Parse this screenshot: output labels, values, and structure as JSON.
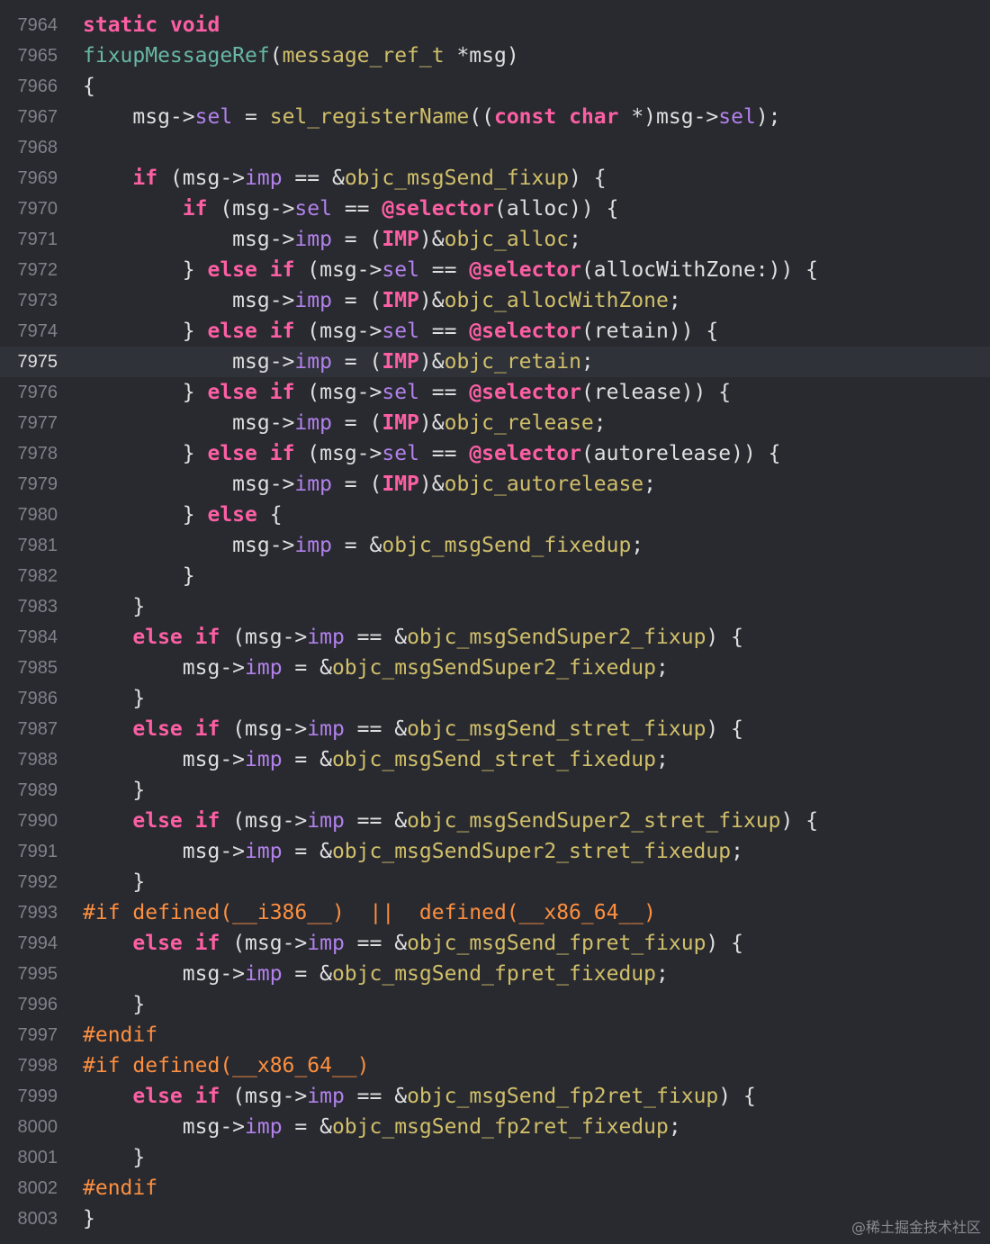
{
  "editor": {
    "current_line": "7975",
    "lines": [
      {
        "num": "7964",
        "tokens": [
          [
            "kw",
            "static"
          ],
          [
            "p",
            " "
          ],
          [
            "kw",
            "void"
          ]
        ]
      },
      {
        "num": "7965",
        "tokens": [
          [
            "fn",
            "fixupMessageRef"
          ],
          [
            "p",
            "("
          ],
          [
            "ty",
            "message_ref_t"
          ],
          [
            "p",
            " *msg)"
          ]
        ]
      },
      {
        "num": "7966",
        "tokens": [
          [
            "p",
            "{"
          ]
        ]
      },
      {
        "num": "7967",
        "tokens": [
          [
            "p",
            "    msg->"
          ],
          [
            "prop",
            "sel"
          ],
          [
            "p",
            " = "
          ],
          [
            "ty",
            "sel_registerName"
          ],
          [
            "p",
            "(("
          ],
          [
            "kw",
            "const"
          ],
          [
            "p",
            " "
          ],
          [
            "kw",
            "char"
          ],
          [
            "p",
            " *)msg->"
          ],
          [
            "prop",
            "sel"
          ],
          [
            "p",
            ");"
          ]
        ]
      },
      {
        "num": "7968",
        "tokens": []
      },
      {
        "num": "7969",
        "tokens": [
          [
            "p",
            "    "
          ],
          [
            "kw",
            "if"
          ],
          [
            "p",
            " (msg->"
          ],
          [
            "prop",
            "imp"
          ],
          [
            "p",
            " == &"
          ],
          [
            "ty",
            "objc_msgSend_fixup"
          ],
          [
            "p",
            ") {"
          ]
        ]
      },
      {
        "num": "7970",
        "tokens": [
          [
            "p",
            "        "
          ],
          [
            "kw",
            "if"
          ],
          [
            "p",
            " (msg->"
          ],
          [
            "prop",
            "sel"
          ],
          [
            "p",
            " == "
          ],
          [
            "kw",
            "@selector"
          ],
          [
            "p",
            "(alloc)) {"
          ]
        ]
      },
      {
        "num": "7971",
        "tokens": [
          [
            "p",
            "            msg->"
          ],
          [
            "prop",
            "imp"
          ],
          [
            "p",
            " = ("
          ],
          [
            "kw",
            "IMP"
          ],
          [
            "p",
            ")&"
          ],
          [
            "ty",
            "objc_alloc"
          ],
          [
            "p",
            ";"
          ]
        ]
      },
      {
        "num": "7972",
        "tokens": [
          [
            "p",
            "        } "
          ],
          [
            "kw",
            "else"
          ],
          [
            "p",
            " "
          ],
          [
            "kw",
            "if"
          ],
          [
            "p",
            " (msg->"
          ],
          [
            "prop",
            "sel"
          ],
          [
            "p",
            " == "
          ],
          [
            "kw",
            "@selector"
          ],
          [
            "p",
            "(allocWithZone:)) {"
          ]
        ]
      },
      {
        "num": "7973",
        "tokens": [
          [
            "p",
            "            msg->"
          ],
          [
            "prop",
            "imp"
          ],
          [
            "p",
            " = ("
          ],
          [
            "kw",
            "IMP"
          ],
          [
            "p",
            ")&"
          ],
          [
            "ty",
            "objc_allocWithZone"
          ],
          [
            "p",
            ";"
          ]
        ]
      },
      {
        "num": "7974",
        "tokens": [
          [
            "p",
            "        } "
          ],
          [
            "kw",
            "else"
          ],
          [
            "p",
            " "
          ],
          [
            "kw",
            "if"
          ],
          [
            "p",
            " (msg->"
          ],
          [
            "prop",
            "sel"
          ],
          [
            "p",
            " == "
          ],
          [
            "kw",
            "@selector"
          ],
          [
            "p",
            "(retain)) {"
          ]
        ]
      },
      {
        "num": "7975",
        "tokens": [
          [
            "p",
            "            msg->"
          ],
          [
            "prop",
            "imp"
          ],
          [
            "p",
            " = ("
          ],
          [
            "kw",
            "IMP"
          ],
          [
            "p",
            ")&"
          ],
          [
            "ty",
            "objc_retain"
          ],
          [
            "p",
            ";"
          ]
        ]
      },
      {
        "num": "7976",
        "tokens": [
          [
            "p",
            "        } "
          ],
          [
            "kw",
            "else"
          ],
          [
            "p",
            " "
          ],
          [
            "kw",
            "if"
          ],
          [
            "p",
            " (msg->"
          ],
          [
            "prop",
            "sel"
          ],
          [
            "p",
            " == "
          ],
          [
            "kw",
            "@selector"
          ],
          [
            "p",
            "(release)) {"
          ]
        ]
      },
      {
        "num": "7977",
        "tokens": [
          [
            "p",
            "            msg->"
          ],
          [
            "prop",
            "imp"
          ],
          [
            "p",
            " = ("
          ],
          [
            "kw",
            "IMP"
          ],
          [
            "p",
            ")&"
          ],
          [
            "ty",
            "objc_release"
          ],
          [
            "p",
            ";"
          ]
        ]
      },
      {
        "num": "7978",
        "tokens": [
          [
            "p",
            "        } "
          ],
          [
            "kw",
            "else"
          ],
          [
            "p",
            " "
          ],
          [
            "kw",
            "if"
          ],
          [
            "p",
            " (msg->"
          ],
          [
            "prop",
            "sel"
          ],
          [
            "p",
            " == "
          ],
          [
            "kw",
            "@selector"
          ],
          [
            "p",
            "(autorelease)) {"
          ]
        ]
      },
      {
        "num": "7979",
        "tokens": [
          [
            "p",
            "            msg->"
          ],
          [
            "prop",
            "imp"
          ],
          [
            "p",
            " = ("
          ],
          [
            "kw",
            "IMP"
          ],
          [
            "p",
            ")&"
          ],
          [
            "ty",
            "objc_autorelease"
          ],
          [
            "p",
            ";"
          ]
        ]
      },
      {
        "num": "7980",
        "tokens": [
          [
            "p",
            "        } "
          ],
          [
            "kw",
            "else"
          ],
          [
            "p",
            " {"
          ]
        ]
      },
      {
        "num": "7981",
        "tokens": [
          [
            "p",
            "            msg->"
          ],
          [
            "prop",
            "imp"
          ],
          [
            "p",
            " = &"
          ],
          [
            "ty",
            "objc_msgSend_fixedup"
          ],
          [
            "p",
            ";"
          ]
        ]
      },
      {
        "num": "7982",
        "tokens": [
          [
            "p",
            "        }"
          ]
        ]
      },
      {
        "num": "7983",
        "tokens": [
          [
            "p",
            "    }"
          ]
        ]
      },
      {
        "num": "7984",
        "tokens": [
          [
            "p",
            "    "
          ],
          [
            "kw",
            "else"
          ],
          [
            "p",
            " "
          ],
          [
            "kw",
            "if"
          ],
          [
            "p",
            " (msg->"
          ],
          [
            "prop",
            "imp"
          ],
          [
            "p",
            " == &"
          ],
          [
            "ty",
            "objc_msgSendSuper2_fixup"
          ],
          [
            "p",
            ") {"
          ]
        ]
      },
      {
        "num": "7985",
        "tokens": [
          [
            "p",
            "        msg->"
          ],
          [
            "prop",
            "imp"
          ],
          [
            "p",
            " = &"
          ],
          [
            "ty",
            "objc_msgSendSuper2_fixedup"
          ],
          [
            "p",
            ";"
          ]
        ]
      },
      {
        "num": "7986",
        "tokens": [
          [
            "p",
            "    }"
          ]
        ]
      },
      {
        "num": "7987",
        "tokens": [
          [
            "p",
            "    "
          ],
          [
            "kw",
            "else"
          ],
          [
            "p",
            " "
          ],
          [
            "kw",
            "if"
          ],
          [
            "p",
            " (msg->"
          ],
          [
            "prop",
            "imp"
          ],
          [
            "p",
            " == &"
          ],
          [
            "ty",
            "objc_msgSend_stret_fixup"
          ],
          [
            "p",
            ") {"
          ]
        ]
      },
      {
        "num": "7988",
        "tokens": [
          [
            "p",
            "        msg->"
          ],
          [
            "prop",
            "imp"
          ],
          [
            "p",
            " = &"
          ],
          [
            "ty",
            "objc_msgSend_stret_fixedup"
          ],
          [
            "p",
            ";"
          ]
        ]
      },
      {
        "num": "7989",
        "tokens": [
          [
            "p",
            "    }"
          ]
        ]
      },
      {
        "num": "7990",
        "tokens": [
          [
            "p",
            "    "
          ],
          [
            "kw",
            "else"
          ],
          [
            "p",
            " "
          ],
          [
            "kw",
            "if"
          ],
          [
            "p",
            " (msg->"
          ],
          [
            "prop",
            "imp"
          ],
          [
            "p",
            " == &"
          ],
          [
            "ty",
            "objc_msgSendSuper2_stret_fixup"
          ],
          [
            "p",
            ") {"
          ]
        ]
      },
      {
        "num": "7991",
        "tokens": [
          [
            "p",
            "        msg->"
          ],
          [
            "prop",
            "imp"
          ],
          [
            "p",
            " = &"
          ],
          [
            "ty",
            "objc_msgSendSuper2_stret_fixedup"
          ],
          [
            "p",
            ";"
          ]
        ]
      },
      {
        "num": "7992",
        "tokens": [
          [
            "p",
            "    }"
          ]
        ]
      },
      {
        "num": "7993",
        "tokens": [
          [
            "pp",
            "#if defined(__i386__)  ||  defined(__x86_64__)"
          ]
        ]
      },
      {
        "num": "7994",
        "tokens": [
          [
            "p",
            "    "
          ],
          [
            "kw",
            "else"
          ],
          [
            "p",
            " "
          ],
          [
            "kw",
            "if"
          ],
          [
            "p",
            " (msg->"
          ],
          [
            "prop",
            "imp"
          ],
          [
            "p",
            " == &"
          ],
          [
            "ty",
            "objc_msgSend_fpret_fixup"
          ],
          [
            "p",
            ") {"
          ]
        ]
      },
      {
        "num": "7995",
        "tokens": [
          [
            "p",
            "        msg->"
          ],
          [
            "prop",
            "imp"
          ],
          [
            "p",
            " = &"
          ],
          [
            "ty",
            "objc_msgSend_fpret_fixedup"
          ],
          [
            "p",
            ";"
          ]
        ]
      },
      {
        "num": "7996",
        "tokens": [
          [
            "p",
            "    }"
          ]
        ]
      },
      {
        "num": "7997",
        "tokens": [
          [
            "pp",
            "#endif"
          ]
        ]
      },
      {
        "num": "7998",
        "tokens": [
          [
            "pp",
            "#if defined(__x86_64__)"
          ]
        ]
      },
      {
        "num": "7999",
        "tokens": [
          [
            "p",
            "    "
          ],
          [
            "kw",
            "else"
          ],
          [
            "p",
            " "
          ],
          [
            "kw",
            "if"
          ],
          [
            "p",
            " (msg->"
          ],
          [
            "prop",
            "imp"
          ],
          [
            "p",
            " == &"
          ],
          [
            "ty",
            "objc_msgSend_fp2ret_fixup"
          ],
          [
            "p",
            ") {"
          ]
        ]
      },
      {
        "num": "8000",
        "tokens": [
          [
            "p",
            "        msg->"
          ],
          [
            "prop",
            "imp"
          ],
          [
            "p",
            " = &"
          ],
          [
            "ty",
            "objc_msgSend_fp2ret_fixedup"
          ],
          [
            "p",
            ";"
          ]
        ]
      },
      {
        "num": "8001",
        "tokens": [
          [
            "p",
            "    }"
          ]
        ]
      },
      {
        "num": "8002",
        "tokens": [
          [
            "pp",
            "#endif"
          ]
        ]
      },
      {
        "num": "8003",
        "tokens": [
          [
            "p",
            "}"
          ]
        ]
      }
    ]
  },
  "colors": {
    "background": "#292a30",
    "current_line_bg": "#2f3239",
    "gutter_text": "#7f8089",
    "keyword": "#fc5fa3",
    "function_decl": "#67b7a4",
    "other_function": "#d0bf69",
    "property": "#b281eb",
    "preprocessor": "#fd8f3f",
    "plain": "#dfdfe0"
  },
  "watermark": "@稀土掘金技术社区"
}
